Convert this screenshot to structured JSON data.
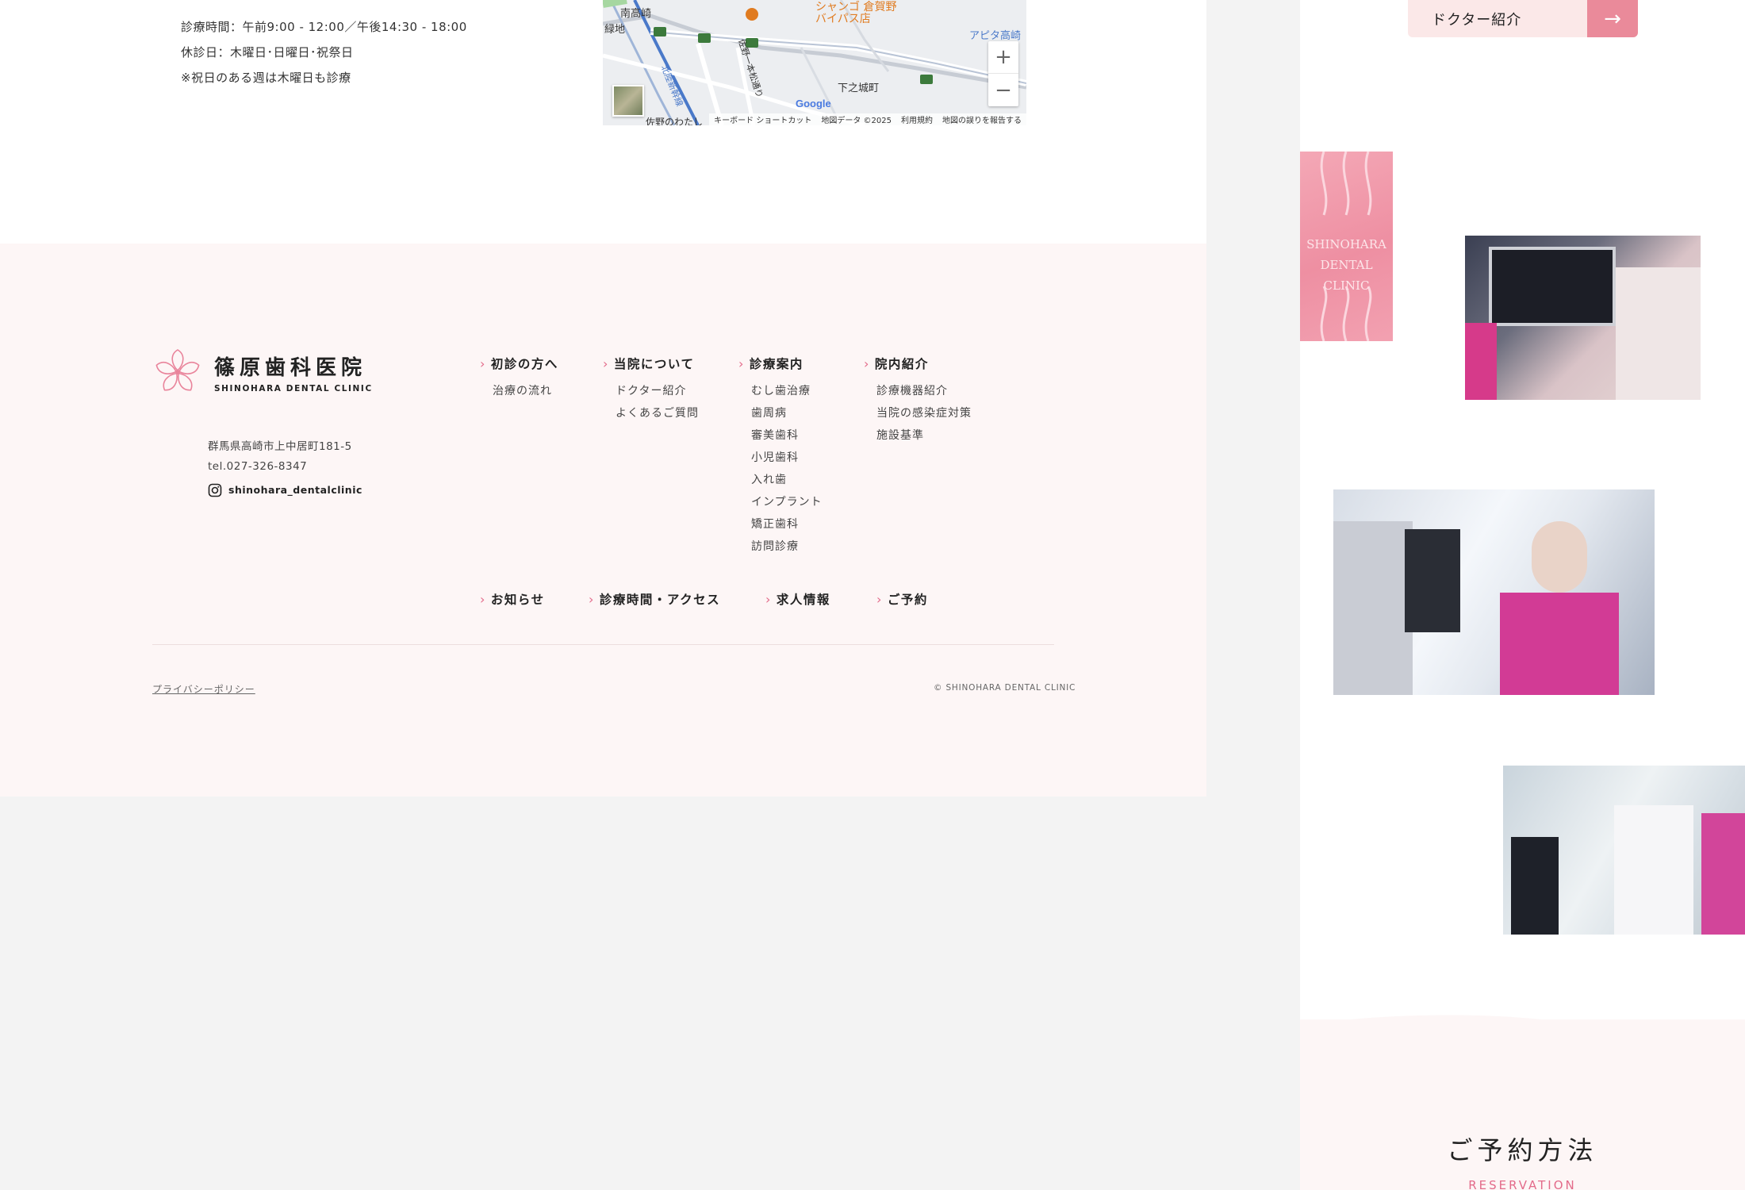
{
  "hours": {
    "line1": "診療時間：午前9:00 - 12:00／午後14:30 - 18:00",
    "line2": "休診日：木曜日･日曜日･祝祭日",
    "line3": "※祝日のある週は木曜日も診療"
  },
  "map": {
    "labels": {
      "station": "南高崎",
      "area": "緑地",
      "poi_line1": "シャンゴ 倉賀野",
      "poi_line2": "バイパス店",
      "store": "アピタ高崎",
      "town": "下之城町",
      "street1": "佐野一本松通り",
      "street2": "北陸新幹線",
      "bottom": "佐野のわたし"
    },
    "route_numbers": [
      "17",
      "12",
      "17"
    ],
    "zoom_in": "+",
    "zoom_out": "−",
    "google": "Google",
    "attribution": [
      "キーボード ショートカット",
      "地図データ ©2025",
      "利用規約",
      "地図の誤りを報告する"
    ]
  },
  "footer": {
    "logo_jp": "篠原歯科医院",
    "logo_en": "SHINOHARA DENTAL CLINIC",
    "address": "群馬県高崎市上中居町181-5",
    "tel": "tel.027-326-8347",
    "instagram": "shinohara_dentalclinic",
    "nav": [
      {
        "label": "初診の方へ",
        "items": [
          "治療の流れ"
        ]
      },
      {
        "label": "当院について",
        "items": [
          "ドクター紹介",
          "よくあるご質問"
        ]
      },
      {
        "label": "診療案内",
        "items": [
          "むし歯治療",
          "歯周病",
          "審美歯科",
          "小児歯科",
          "入れ歯",
          "インプラント",
          "矯正歯科",
          "訪問診療"
        ]
      },
      {
        "label": "院内紹介",
        "items": [
          "診療機器紹介",
          "当院の感染症対策",
          "施設基準"
        ]
      }
    ],
    "nav_bottom": [
      "お知らせ",
      "診療時間・アクセス",
      "求人情報",
      "ご予約"
    ],
    "privacy": "プライバシーポリシー",
    "copyright": "© SHINOHARA DENTAL CLINIC"
  },
  "side": {
    "doctor_button": "ドクター紹介",
    "photo1_sign_line1": "SHINOHARA",
    "photo1_sign_line2": "DENTAL CLINIC",
    "reserve_title": "ご予約方法",
    "reserve_en": "RESERVATION"
  },
  "colors": {
    "accent_pink": "#e36b8a",
    "footer_bg": "#fdf6f6",
    "button_pink": "#ea8a9a"
  }
}
